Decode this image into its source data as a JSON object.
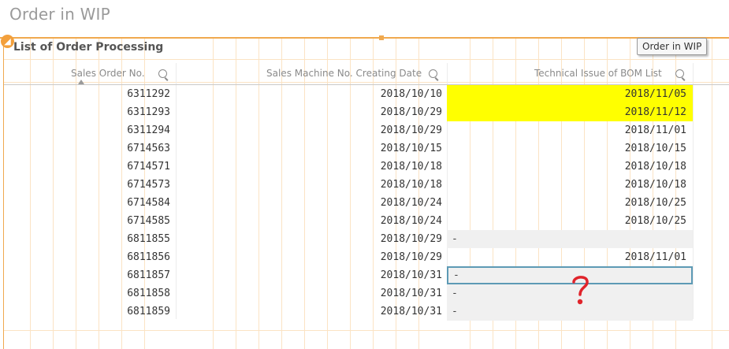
{
  "page": {
    "title": "Order in WIP"
  },
  "object": {
    "title": "List of Order Processing",
    "tooltip": "Order in WIP"
  },
  "table": {
    "columns": [
      {
        "label": "Sales Order No."
      },
      {
        "label": "Sales Machine No. Creating Date"
      },
      {
        "label": "Technical Issue of BOM List"
      }
    ],
    "rows": [
      {
        "order": "6311292",
        "created": "2018/10/10",
        "bom": "2018/11/05",
        "highlight": "yellow"
      },
      {
        "order": "6311293",
        "created": "2018/10/29",
        "bom": "2018/11/12",
        "highlight": "yellow"
      },
      {
        "order": "6311294",
        "created": "2018/10/29",
        "bom": "2018/11/01",
        "highlight": ""
      },
      {
        "order": "6714563",
        "created": "2018/10/15",
        "bom": "2018/10/15",
        "highlight": ""
      },
      {
        "order": "6714571",
        "created": "2018/10/18",
        "bom": "2018/10/18",
        "highlight": ""
      },
      {
        "order": "6714573",
        "created": "2018/10/18",
        "bom": "2018/10/18",
        "highlight": ""
      },
      {
        "order": "6714584",
        "created": "2018/10/24",
        "bom": "2018/10/25",
        "highlight": ""
      },
      {
        "order": "6714585",
        "created": "2018/10/24",
        "bom": "2018/10/25",
        "highlight": ""
      },
      {
        "order": "6811855",
        "created": "2018/10/29",
        "bom": "-",
        "highlight": "null"
      },
      {
        "order": "6811856",
        "created": "2018/10/29",
        "bom": "2018/11/01",
        "highlight": ""
      },
      {
        "order": "6811857",
        "created": "2018/10/31",
        "bom": "-",
        "highlight": "selected"
      },
      {
        "order": "6811858",
        "created": "2018/10/31",
        "bom": "-",
        "highlight": "null"
      },
      {
        "order": "6811859",
        "created": "2018/10/31",
        "bom": "-",
        "highlight": "null"
      }
    ]
  },
  "colors": {
    "accent": "#f0a94f",
    "highlight_yellow": "#ffff00",
    "null_gray": "#f0f0f0",
    "selection": "#5d9ab5",
    "annotation": "#e0242b"
  },
  "icons": [
    "search-icon",
    "sort-ascending-icon",
    "object-menu-icon"
  ],
  "annotation": {
    "text": "?"
  }
}
